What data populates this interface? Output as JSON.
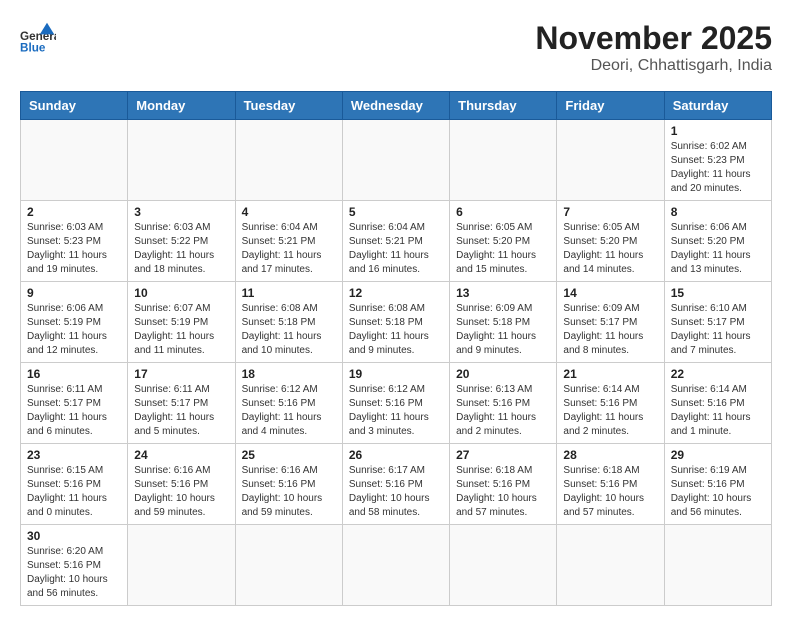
{
  "header": {
    "logo_general": "General",
    "logo_blue": "Blue",
    "title": "November 2025",
    "subtitle": "Deori, Chhattisgarh, India"
  },
  "calendar": {
    "days_of_week": [
      "Sunday",
      "Monday",
      "Tuesday",
      "Wednesday",
      "Thursday",
      "Friday",
      "Saturday"
    ],
    "weeks": [
      [
        {
          "day": "",
          "info": ""
        },
        {
          "day": "",
          "info": ""
        },
        {
          "day": "",
          "info": ""
        },
        {
          "day": "",
          "info": ""
        },
        {
          "day": "",
          "info": ""
        },
        {
          "day": "",
          "info": ""
        },
        {
          "day": "1",
          "info": "Sunrise: 6:02 AM\nSunset: 5:23 PM\nDaylight: 11 hours\nand 20 minutes."
        }
      ],
      [
        {
          "day": "2",
          "info": "Sunrise: 6:03 AM\nSunset: 5:23 PM\nDaylight: 11 hours\nand 19 minutes."
        },
        {
          "day": "3",
          "info": "Sunrise: 6:03 AM\nSunset: 5:22 PM\nDaylight: 11 hours\nand 18 minutes."
        },
        {
          "day": "4",
          "info": "Sunrise: 6:04 AM\nSunset: 5:21 PM\nDaylight: 11 hours\nand 17 minutes."
        },
        {
          "day": "5",
          "info": "Sunrise: 6:04 AM\nSunset: 5:21 PM\nDaylight: 11 hours\nand 16 minutes."
        },
        {
          "day": "6",
          "info": "Sunrise: 6:05 AM\nSunset: 5:20 PM\nDaylight: 11 hours\nand 15 minutes."
        },
        {
          "day": "7",
          "info": "Sunrise: 6:05 AM\nSunset: 5:20 PM\nDaylight: 11 hours\nand 14 minutes."
        },
        {
          "day": "8",
          "info": "Sunrise: 6:06 AM\nSunset: 5:20 PM\nDaylight: 11 hours\nand 13 minutes."
        }
      ],
      [
        {
          "day": "9",
          "info": "Sunrise: 6:06 AM\nSunset: 5:19 PM\nDaylight: 11 hours\nand 12 minutes."
        },
        {
          "day": "10",
          "info": "Sunrise: 6:07 AM\nSunset: 5:19 PM\nDaylight: 11 hours\nand 11 minutes."
        },
        {
          "day": "11",
          "info": "Sunrise: 6:08 AM\nSunset: 5:18 PM\nDaylight: 11 hours\nand 10 minutes."
        },
        {
          "day": "12",
          "info": "Sunrise: 6:08 AM\nSunset: 5:18 PM\nDaylight: 11 hours\nand 9 minutes."
        },
        {
          "day": "13",
          "info": "Sunrise: 6:09 AM\nSunset: 5:18 PM\nDaylight: 11 hours\nand 9 minutes."
        },
        {
          "day": "14",
          "info": "Sunrise: 6:09 AM\nSunset: 5:17 PM\nDaylight: 11 hours\nand 8 minutes."
        },
        {
          "day": "15",
          "info": "Sunrise: 6:10 AM\nSunset: 5:17 PM\nDaylight: 11 hours\nand 7 minutes."
        }
      ],
      [
        {
          "day": "16",
          "info": "Sunrise: 6:11 AM\nSunset: 5:17 PM\nDaylight: 11 hours\nand 6 minutes."
        },
        {
          "day": "17",
          "info": "Sunrise: 6:11 AM\nSunset: 5:17 PM\nDaylight: 11 hours\nand 5 minutes."
        },
        {
          "day": "18",
          "info": "Sunrise: 6:12 AM\nSunset: 5:16 PM\nDaylight: 11 hours\nand 4 minutes."
        },
        {
          "day": "19",
          "info": "Sunrise: 6:12 AM\nSunset: 5:16 PM\nDaylight: 11 hours\nand 3 minutes."
        },
        {
          "day": "20",
          "info": "Sunrise: 6:13 AM\nSunset: 5:16 PM\nDaylight: 11 hours\nand 2 minutes."
        },
        {
          "day": "21",
          "info": "Sunrise: 6:14 AM\nSunset: 5:16 PM\nDaylight: 11 hours\nand 2 minutes."
        },
        {
          "day": "22",
          "info": "Sunrise: 6:14 AM\nSunset: 5:16 PM\nDaylight: 11 hours\nand 1 minute."
        }
      ],
      [
        {
          "day": "23",
          "info": "Sunrise: 6:15 AM\nSunset: 5:16 PM\nDaylight: 11 hours\nand 0 minutes."
        },
        {
          "day": "24",
          "info": "Sunrise: 6:16 AM\nSunset: 5:16 PM\nDaylight: 10 hours\nand 59 minutes."
        },
        {
          "day": "25",
          "info": "Sunrise: 6:16 AM\nSunset: 5:16 PM\nDaylight: 10 hours\nand 59 minutes."
        },
        {
          "day": "26",
          "info": "Sunrise: 6:17 AM\nSunset: 5:16 PM\nDaylight: 10 hours\nand 58 minutes."
        },
        {
          "day": "27",
          "info": "Sunrise: 6:18 AM\nSunset: 5:16 PM\nDaylight: 10 hours\nand 57 minutes."
        },
        {
          "day": "28",
          "info": "Sunrise: 6:18 AM\nSunset: 5:16 PM\nDaylight: 10 hours\nand 57 minutes."
        },
        {
          "day": "29",
          "info": "Sunrise: 6:19 AM\nSunset: 5:16 PM\nDaylight: 10 hours\nand 56 minutes."
        }
      ],
      [
        {
          "day": "30",
          "info": "Sunrise: 6:20 AM\nSunset: 5:16 PM\nDaylight: 10 hours\nand 56 minutes."
        },
        {
          "day": "",
          "info": ""
        },
        {
          "day": "",
          "info": ""
        },
        {
          "day": "",
          "info": ""
        },
        {
          "day": "",
          "info": ""
        },
        {
          "day": "",
          "info": ""
        },
        {
          "day": "",
          "info": ""
        }
      ]
    ]
  }
}
